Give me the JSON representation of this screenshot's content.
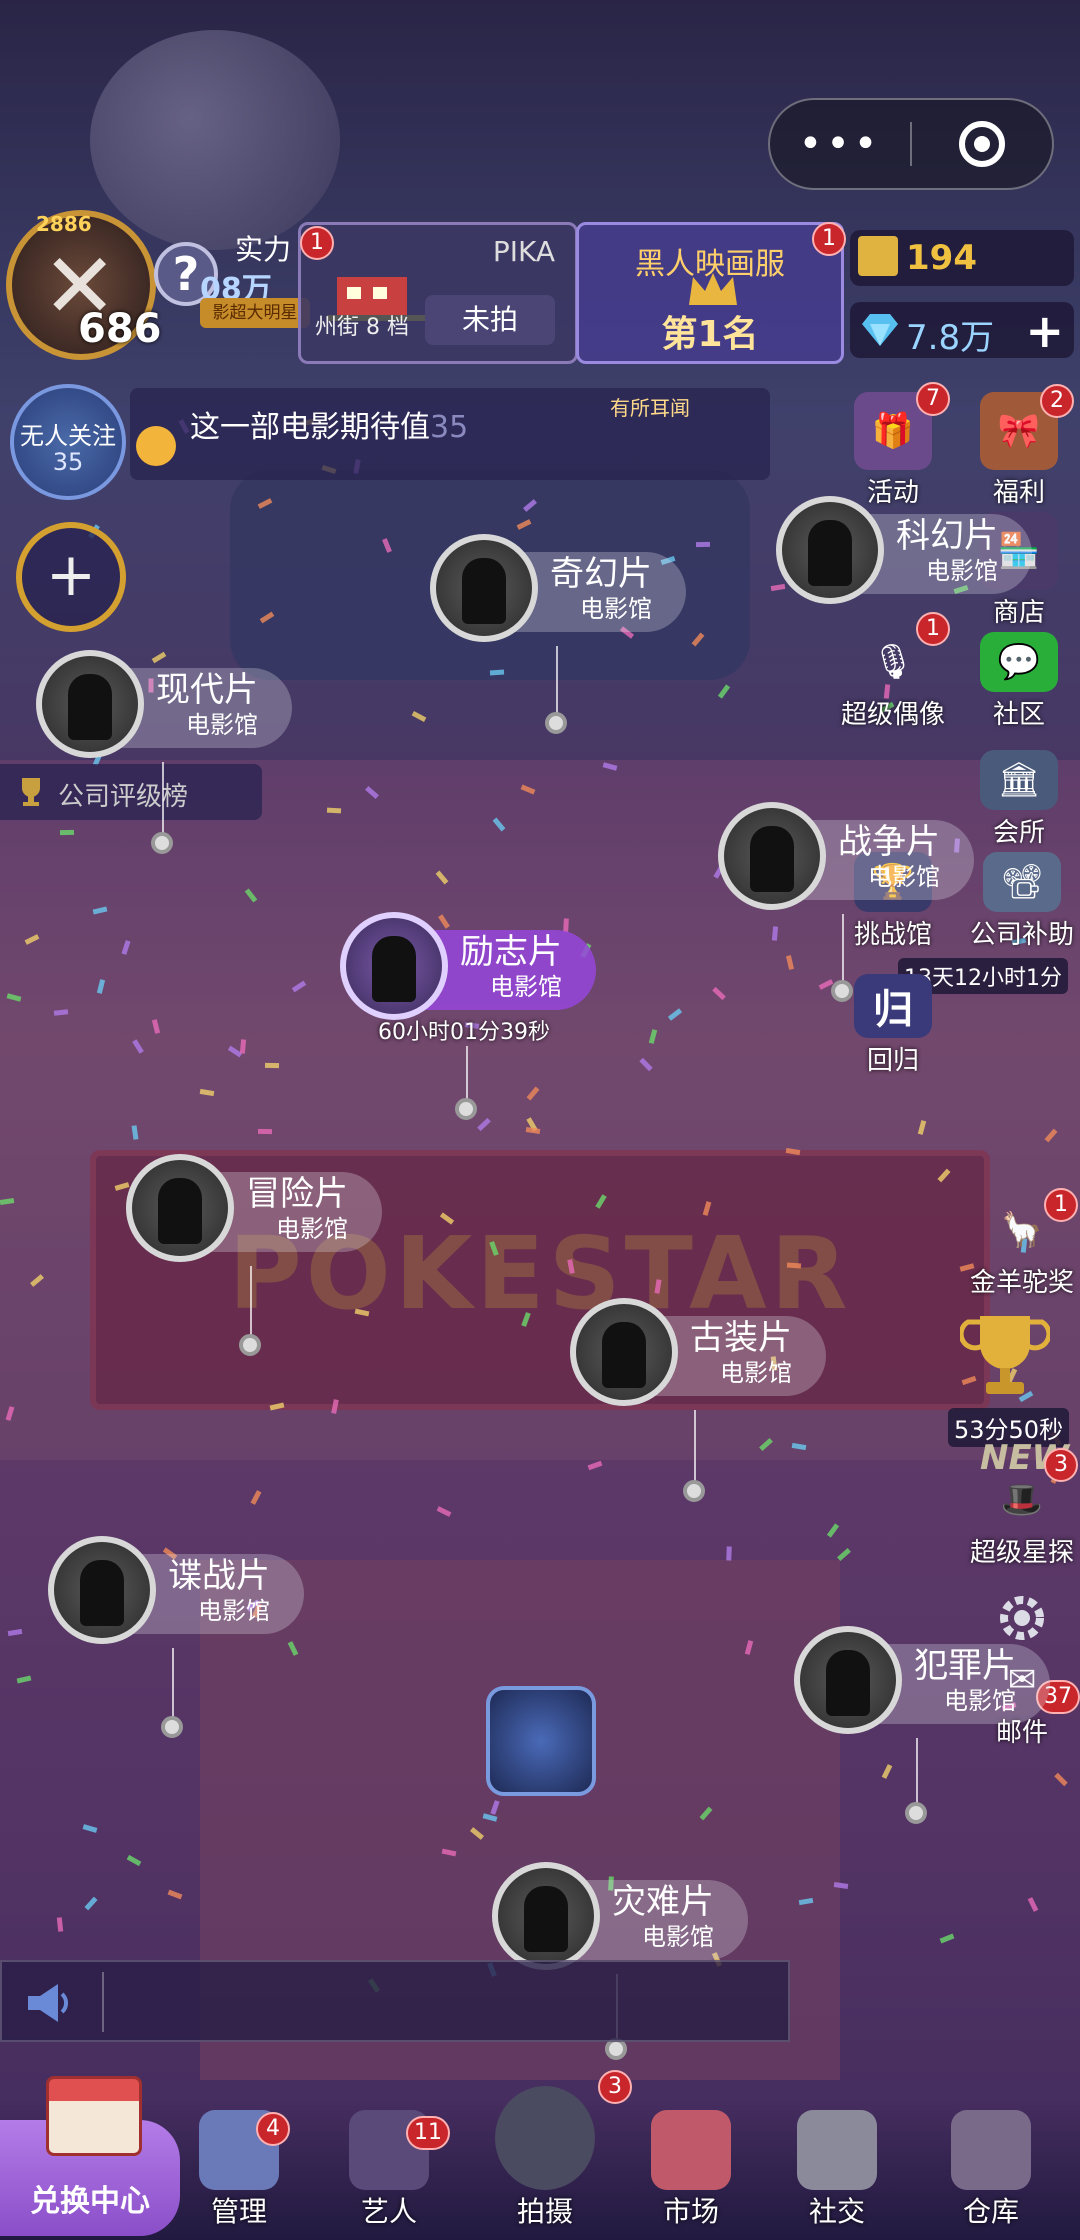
{
  "player": {
    "level": "686",
    "avatar_top": "2886",
    "power_label": "实力",
    "power_value": "08万",
    "power_badge": "影超大明星"
  },
  "pika_card": {
    "title": "PIKA",
    "address": "州街 8 档",
    "status": "未拍",
    "badge": "1"
  },
  "rank_card": {
    "title": "黑人映画服",
    "value": "第1名",
    "badge": "1"
  },
  "currency": {
    "gold": "194",
    "gems": "7.8万",
    "gems_plus": "+"
  },
  "follower": {
    "label": "无人关注",
    "value": "35"
  },
  "expectation": {
    "text": "这一部电影期待值",
    "value": "35",
    "tag": "有所耳闻"
  },
  "add_button": "+",
  "company_rating": "公司评级榜",
  "side_menu": {
    "activity": {
      "label": "活动",
      "badge": "7"
    },
    "welfare": {
      "label": "福利",
      "badge": "2"
    },
    "shop": {
      "label": "商店"
    },
    "super_idol": {
      "label": "超级偶像",
      "badge": "1"
    },
    "community": {
      "label": "社区"
    },
    "club": {
      "label": "会所"
    },
    "challenge": {
      "label": "挑战馆"
    },
    "company_subsidy": {
      "label": "公司补助",
      "timer": "13天12小时1分"
    },
    "return": {
      "label": "回归"
    },
    "golden_ram": {
      "label": "金羊驼奖",
      "badge": "1"
    },
    "trophy_timer": "53分50秒",
    "new_tag": "NEW",
    "super_scout": {
      "label": "超级星探",
      "badge": "3"
    },
    "mail": {
      "label": "邮件",
      "badge": "37"
    }
  },
  "cinemas": [
    {
      "name": "奇幻片",
      "sub": "电影馆"
    },
    {
      "name": "科幻片",
      "sub": "电影馆"
    },
    {
      "name": "现代片",
      "sub": "电影馆"
    },
    {
      "name": "战争片",
      "sub": "电影馆"
    },
    {
      "name": "励志片",
      "sub": "电影馆",
      "timer": "60小时01分39秒"
    },
    {
      "name": "冒险片",
      "sub": "电影馆"
    },
    {
      "name": "古装片",
      "sub": "电影馆"
    },
    {
      "name": "谍战片",
      "sub": "电影馆"
    },
    {
      "name": "犯罪片",
      "sub": "电影馆"
    },
    {
      "name": "灾难片",
      "sub": "电影馆"
    }
  ],
  "bottom_nav": {
    "exchange": "兑换中心",
    "manage": {
      "label": "管理",
      "badge": "4"
    },
    "artist": {
      "label": "艺人",
      "badge": "11"
    },
    "shoot": {
      "label": "拍摄",
      "badge": "3"
    },
    "market": {
      "label": "市场"
    },
    "social": {
      "label": "社交"
    },
    "warehouse": {
      "label": "仓库"
    }
  },
  "colors": {
    "accent_purple": "#8a4ec8",
    "gold": "#f0c040",
    "badge_red": "#c9262c"
  }
}
